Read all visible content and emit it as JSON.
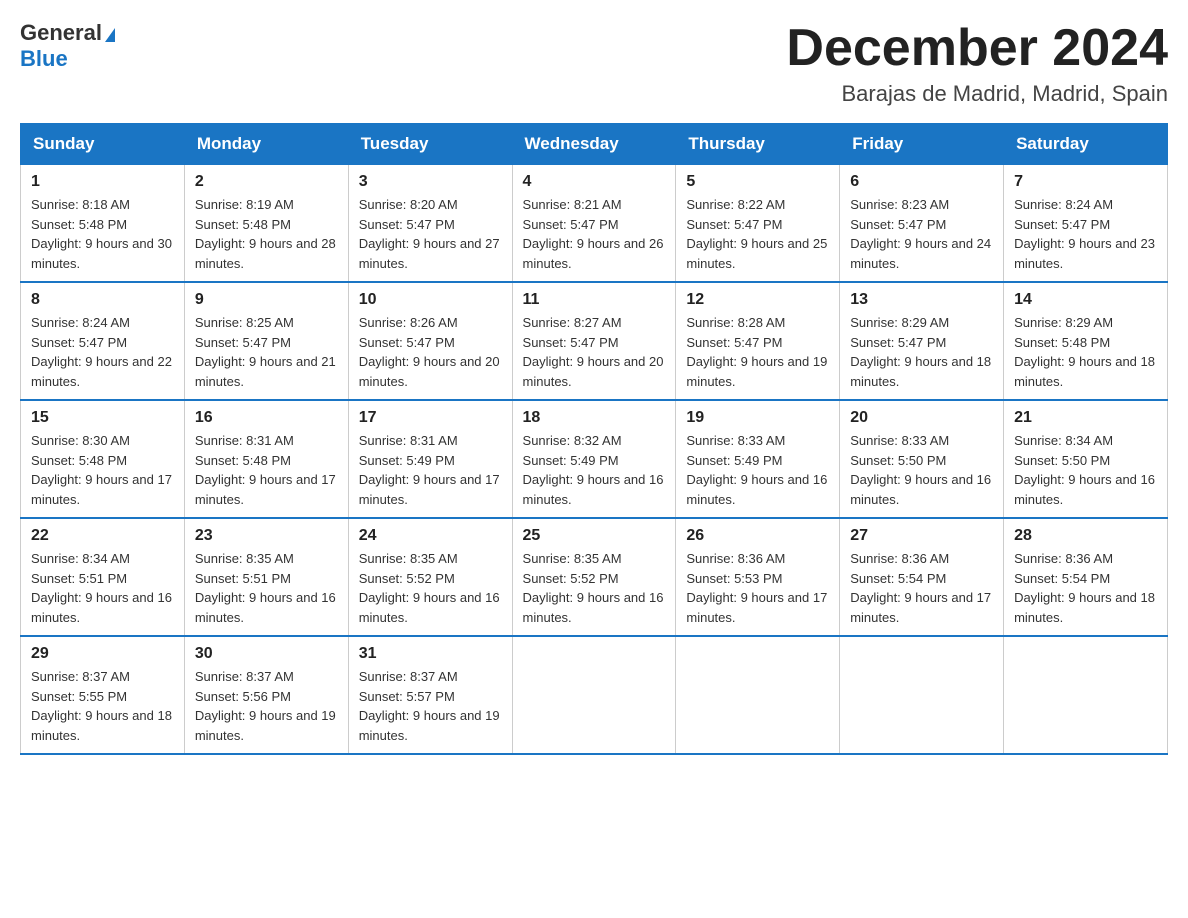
{
  "header": {
    "logo": {
      "general": "General",
      "blue": "Blue"
    },
    "title": "December 2024",
    "subtitle": "Barajas de Madrid, Madrid, Spain"
  },
  "days_of_week": [
    "Sunday",
    "Monday",
    "Tuesday",
    "Wednesday",
    "Thursday",
    "Friday",
    "Saturday"
  ],
  "weeks": [
    [
      {
        "day": "1",
        "sunrise": "8:18 AM",
        "sunset": "5:48 PM",
        "daylight": "9 hours and 30 minutes."
      },
      {
        "day": "2",
        "sunrise": "8:19 AM",
        "sunset": "5:48 PM",
        "daylight": "9 hours and 28 minutes."
      },
      {
        "day": "3",
        "sunrise": "8:20 AM",
        "sunset": "5:47 PM",
        "daylight": "9 hours and 27 minutes."
      },
      {
        "day": "4",
        "sunrise": "8:21 AM",
        "sunset": "5:47 PM",
        "daylight": "9 hours and 26 minutes."
      },
      {
        "day": "5",
        "sunrise": "8:22 AM",
        "sunset": "5:47 PM",
        "daylight": "9 hours and 25 minutes."
      },
      {
        "day": "6",
        "sunrise": "8:23 AM",
        "sunset": "5:47 PM",
        "daylight": "9 hours and 24 minutes."
      },
      {
        "day": "7",
        "sunrise": "8:24 AM",
        "sunset": "5:47 PM",
        "daylight": "9 hours and 23 minutes."
      }
    ],
    [
      {
        "day": "8",
        "sunrise": "8:24 AM",
        "sunset": "5:47 PM",
        "daylight": "9 hours and 22 minutes."
      },
      {
        "day": "9",
        "sunrise": "8:25 AM",
        "sunset": "5:47 PM",
        "daylight": "9 hours and 21 minutes."
      },
      {
        "day": "10",
        "sunrise": "8:26 AM",
        "sunset": "5:47 PM",
        "daylight": "9 hours and 20 minutes."
      },
      {
        "day": "11",
        "sunrise": "8:27 AM",
        "sunset": "5:47 PM",
        "daylight": "9 hours and 20 minutes."
      },
      {
        "day": "12",
        "sunrise": "8:28 AM",
        "sunset": "5:47 PM",
        "daylight": "9 hours and 19 minutes."
      },
      {
        "day": "13",
        "sunrise": "8:29 AM",
        "sunset": "5:47 PM",
        "daylight": "9 hours and 18 minutes."
      },
      {
        "day": "14",
        "sunrise": "8:29 AM",
        "sunset": "5:48 PM",
        "daylight": "9 hours and 18 minutes."
      }
    ],
    [
      {
        "day": "15",
        "sunrise": "8:30 AM",
        "sunset": "5:48 PM",
        "daylight": "9 hours and 17 minutes."
      },
      {
        "day": "16",
        "sunrise": "8:31 AM",
        "sunset": "5:48 PM",
        "daylight": "9 hours and 17 minutes."
      },
      {
        "day": "17",
        "sunrise": "8:31 AM",
        "sunset": "5:49 PM",
        "daylight": "9 hours and 17 minutes."
      },
      {
        "day": "18",
        "sunrise": "8:32 AM",
        "sunset": "5:49 PM",
        "daylight": "9 hours and 16 minutes."
      },
      {
        "day": "19",
        "sunrise": "8:33 AM",
        "sunset": "5:49 PM",
        "daylight": "9 hours and 16 minutes."
      },
      {
        "day": "20",
        "sunrise": "8:33 AM",
        "sunset": "5:50 PM",
        "daylight": "9 hours and 16 minutes."
      },
      {
        "day": "21",
        "sunrise": "8:34 AM",
        "sunset": "5:50 PM",
        "daylight": "9 hours and 16 minutes."
      }
    ],
    [
      {
        "day": "22",
        "sunrise": "8:34 AM",
        "sunset": "5:51 PM",
        "daylight": "9 hours and 16 minutes."
      },
      {
        "day": "23",
        "sunrise": "8:35 AM",
        "sunset": "5:51 PM",
        "daylight": "9 hours and 16 minutes."
      },
      {
        "day": "24",
        "sunrise": "8:35 AM",
        "sunset": "5:52 PM",
        "daylight": "9 hours and 16 minutes."
      },
      {
        "day": "25",
        "sunrise": "8:35 AM",
        "sunset": "5:52 PM",
        "daylight": "9 hours and 16 minutes."
      },
      {
        "day": "26",
        "sunrise": "8:36 AM",
        "sunset": "5:53 PM",
        "daylight": "9 hours and 17 minutes."
      },
      {
        "day": "27",
        "sunrise": "8:36 AM",
        "sunset": "5:54 PM",
        "daylight": "9 hours and 17 minutes."
      },
      {
        "day": "28",
        "sunrise": "8:36 AM",
        "sunset": "5:54 PM",
        "daylight": "9 hours and 18 minutes."
      }
    ],
    [
      {
        "day": "29",
        "sunrise": "8:37 AM",
        "sunset": "5:55 PM",
        "daylight": "9 hours and 18 minutes."
      },
      {
        "day": "30",
        "sunrise": "8:37 AM",
        "sunset": "5:56 PM",
        "daylight": "9 hours and 19 minutes."
      },
      {
        "day": "31",
        "sunrise": "8:37 AM",
        "sunset": "5:57 PM",
        "daylight": "9 hours and 19 minutes."
      },
      null,
      null,
      null,
      null
    ]
  ]
}
